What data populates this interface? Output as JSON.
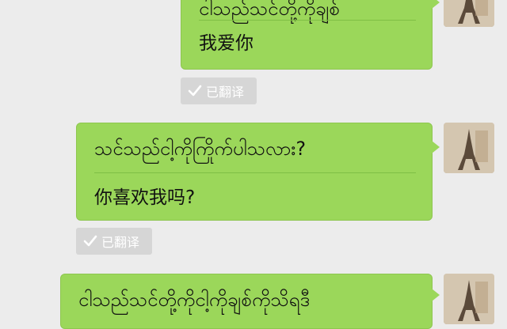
{
  "messages": [
    {
      "original": "ငါသည်သင်တို့ကိုချစ်",
      "translation": "我爱你",
      "translated_badge": "已翻译"
    },
    {
      "original": "သင်သည်ငါ့ကိုကြိုက်ပါသလား?",
      "translation": "你喜欢我吗?",
      "translated_badge": "已翻译"
    },
    {
      "original": "ငါသည်သင်တို့ကိုငါ့ကိုချစ်ကိုသိရဒီ"
    }
  ],
  "colors": {
    "background": "#ececec",
    "bubble": "#9bd75a",
    "badge": "#d6d6d6"
  },
  "icons": {
    "avatar": "eiffel-tower-avatar-icon",
    "translated": "checkmark-icon"
  }
}
